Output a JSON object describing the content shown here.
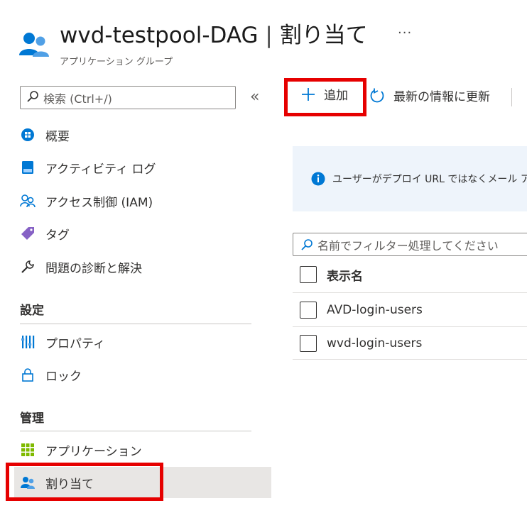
{
  "header": {
    "title_main": "wvd-testpool-DAG",
    "title_sep": "|",
    "title_page": "割り当て",
    "subtitle": "アプリケーション グループ",
    "more": "···"
  },
  "sidebar": {
    "search_placeholder": "検索 (Ctrl+/)",
    "collapse": "«",
    "items": [
      {
        "label": "概要",
        "icon": "overview-icon"
      },
      {
        "label": "アクティビティ ログ",
        "icon": "activity-log-icon"
      },
      {
        "label": "アクセス制御 (IAM)",
        "icon": "iam-icon"
      },
      {
        "label": "タグ",
        "icon": "tag-icon"
      },
      {
        "label": "問題の診断と解決",
        "icon": "wrench-icon"
      }
    ],
    "section_settings": "設定",
    "settings_items": [
      {
        "label": "プロパティ",
        "icon": "properties-icon"
      },
      {
        "label": "ロック",
        "icon": "lock-icon"
      }
    ],
    "section_manage": "管理",
    "manage_items": [
      {
        "label": "アプリケーション",
        "icon": "applications-icon"
      },
      {
        "label": "割り当て",
        "icon": "assignments-icon",
        "selected": true
      }
    ]
  },
  "toolbar": {
    "add_label": "追加",
    "refresh_label": "最新の情報に更新"
  },
  "info": {
    "text": "ユーザーがデプロイ URL ではなくメール ア"
  },
  "filter": {
    "placeholder": "名前でフィルター処理してください"
  },
  "table": {
    "header": "表示名",
    "rows": [
      "AVD-login-users",
      "wvd-login-users"
    ]
  },
  "colors": {
    "accent": "#0078d4",
    "highlight": "#e60000",
    "selected_bg": "#e8e6e4",
    "info_bg": "#eef4fb"
  }
}
